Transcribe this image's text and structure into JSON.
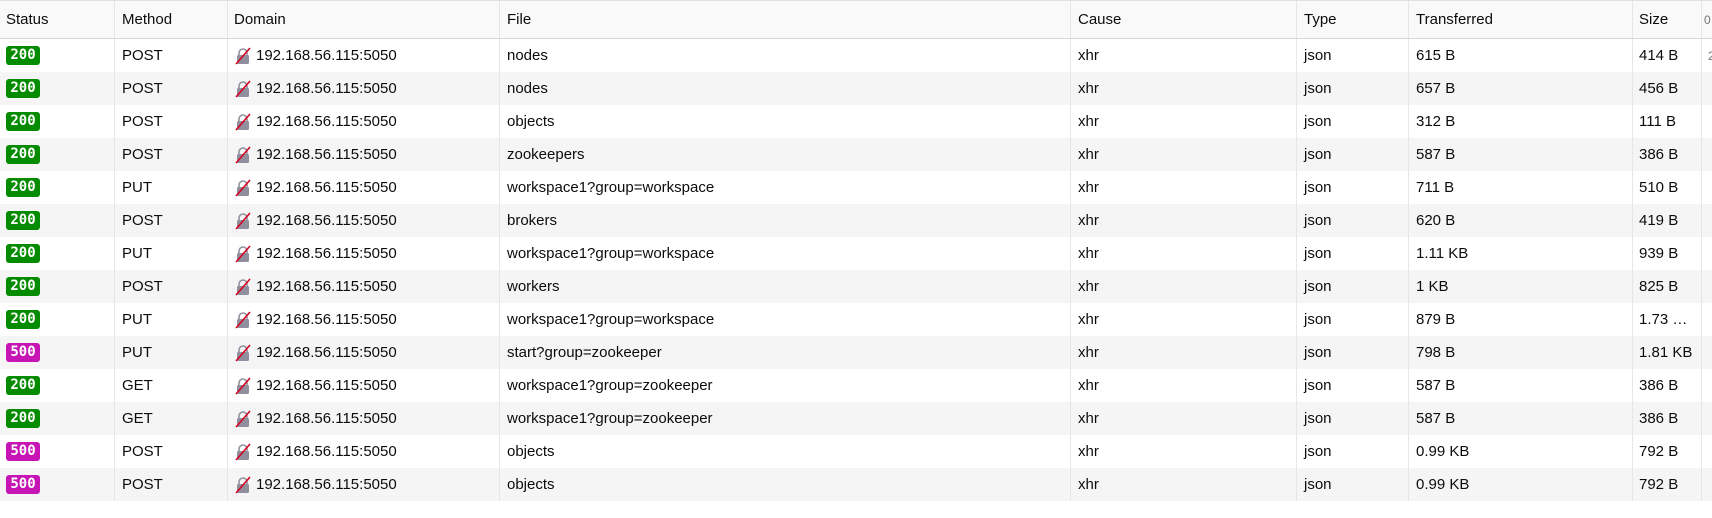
{
  "columns": {
    "status": "Status",
    "method": "Method",
    "domain": "Domain",
    "file": "File",
    "cause": "Cause",
    "type": "Type",
    "transferred": "Transferred",
    "size": "Size",
    "extra": "0"
  },
  "colors": {
    "status_200": "#058b00",
    "status_500": "#c615b4"
  },
  "icons": {
    "domain": "insecure-lock-icon"
  },
  "rows": [
    {
      "status": "200",
      "method": "POST",
      "domain": "192.168.56.115:5050",
      "file": "nodes",
      "cause": "xhr",
      "type": "json",
      "transferred": "615 B",
      "size": "414 B",
      "extra": "2"
    },
    {
      "status": "200",
      "method": "POST",
      "domain": "192.168.56.115:5050",
      "file": "nodes",
      "cause": "xhr",
      "type": "json",
      "transferred": "657 B",
      "size": "456 B",
      "extra": ""
    },
    {
      "status": "200",
      "method": "POST",
      "domain": "192.168.56.115:5050",
      "file": "objects",
      "cause": "xhr",
      "type": "json",
      "transferred": "312 B",
      "size": "111 B",
      "extra": ""
    },
    {
      "status": "200",
      "method": "POST",
      "domain": "192.168.56.115:5050",
      "file": "zookeepers",
      "cause": "xhr",
      "type": "json",
      "transferred": "587 B",
      "size": "386 B",
      "extra": ""
    },
    {
      "status": "200",
      "method": "PUT",
      "domain": "192.168.56.115:5050",
      "file": "workspace1?group=workspace",
      "cause": "xhr",
      "type": "json",
      "transferred": "711 B",
      "size": "510 B",
      "extra": ""
    },
    {
      "status": "200",
      "method": "POST",
      "domain": "192.168.56.115:5050",
      "file": "brokers",
      "cause": "xhr",
      "type": "json",
      "transferred": "620 B",
      "size": "419 B",
      "extra": ""
    },
    {
      "status": "200",
      "method": "PUT",
      "domain": "192.168.56.115:5050",
      "file": "workspace1?group=workspace",
      "cause": "xhr",
      "type": "json",
      "transferred": "1.11 KB",
      "size": "939 B",
      "extra": ""
    },
    {
      "status": "200",
      "method": "POST",
      "domain": "192.168.56.115:5050",
      "file": "workers",
      "cause": "xhr",
      "type": "json",
      "transferred": "1 KB",
      "size": "825 B",
      "extra": ""
    },
    {
      "status": "200",
      "method": "PUT",
      "domain": "192.168.56.115:5050",
      "file": "workspace1?group=workspace",
      "cause": "xhr",
      "type": "json",
      "transferred": "879 B",
      "size": "1.73 …",
      "extra": ""
    },
    {
      "status": "500",
      "method": "PUT",
      "domain": "192.168.56.115:5050",
      "file": "start?group=zookeeper",
      "cause": "xhr",
      "type": "json",
      "transferred": "798 B",
      "size": "1.81 KB",
      "extra": ""
    },
    {
      "status": "200",
      "method": "GET",
      "domain": "192.168.56.115:5050",
      "file": "workspace1?group=zookeeper",
      "cause": "xhr",
      "type": "json",
      "transferred": "587 B",
      "size": "386 B",
      "extra": ""
    },
    {
      "status": "200",
      "method": "GET",
      "domain": "192.168.56.115:5050",
      "file": "workspace1?group=zookeeper",
      "cause": "xhr",
      "type": "json",
      "transferred": "587 B",
      "size": "386 B",
      "extra": ""
    },
    {
      "status": "500",
      "method": "POST",
      "domain": "192.168.56.115:5050",
      "file": "objects",
      "cause": "xhr",
      "type": "json",
      "transferred": "0.99 KB",
      "size": "792 B",
      "extra": ""
    },
    {
      "status": "500",
      "method": "POST",
      "domain": "192.168.56.115:5050",
      "file": "objects",
      "cause": "xhr",
      "type": "json",
      "transferred": "0.99 KB",
      "size": "792 B",
      "extra": ""
    }
  ]
}
